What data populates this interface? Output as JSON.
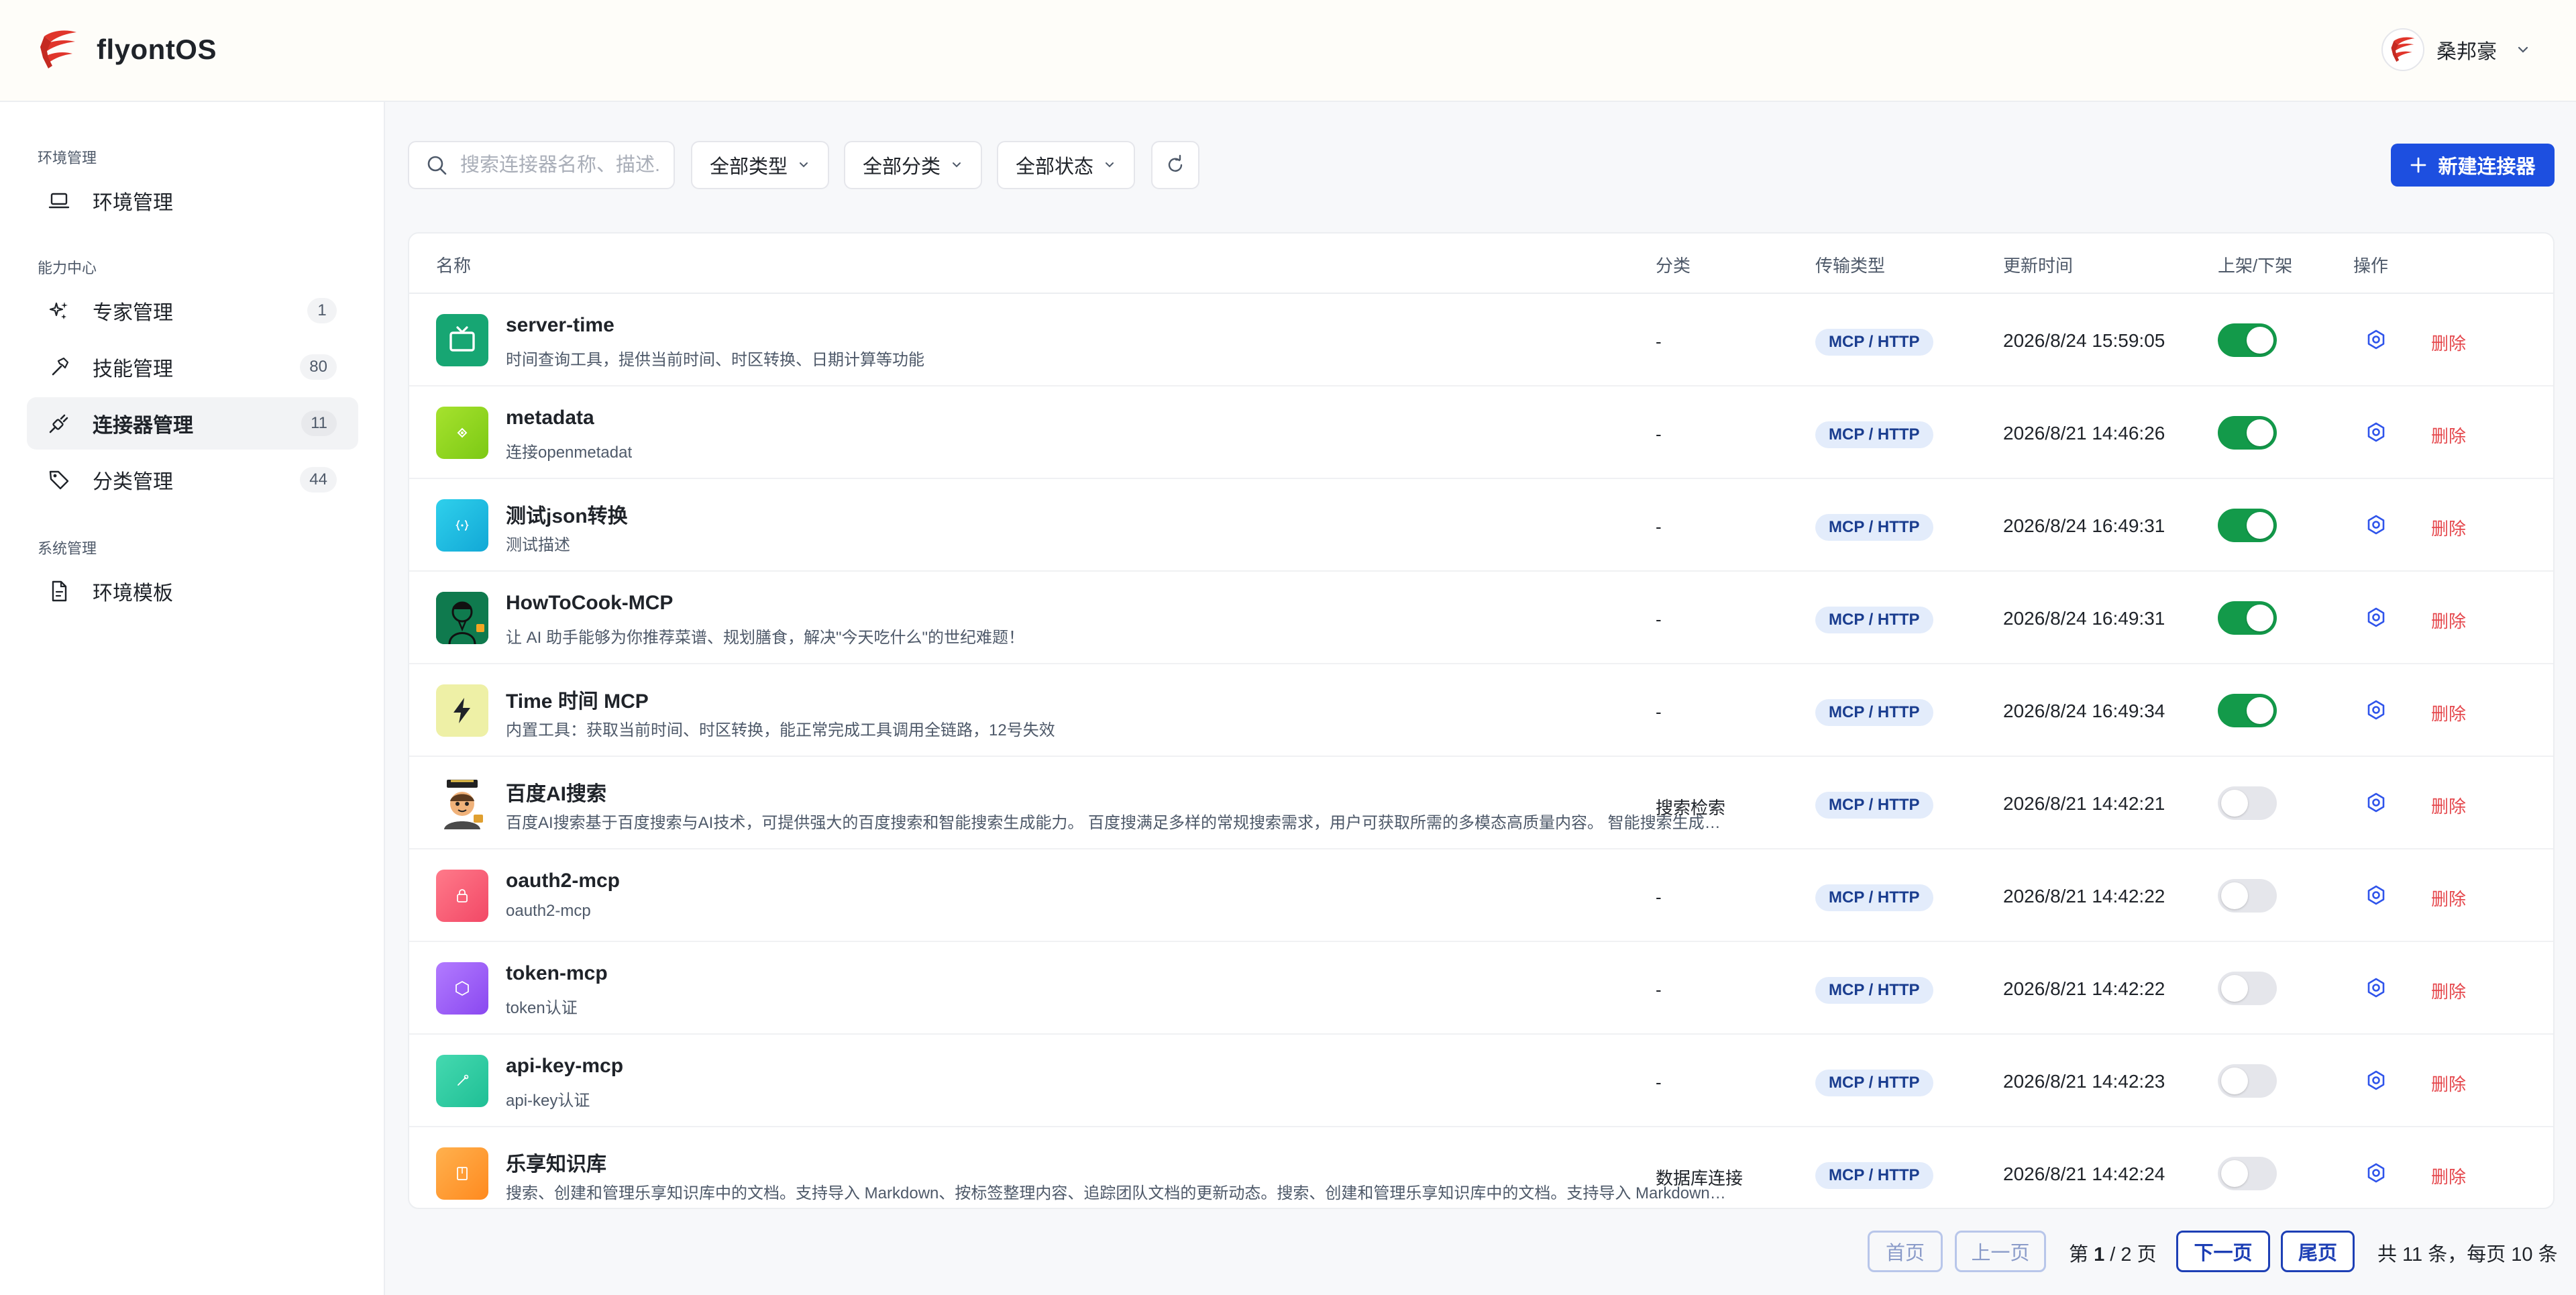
{
  "app": {
    "title": "flyontOS",
    "user_name": "桑邦豪"
  },
  "sidebar": {
    "groups": [
      {
        "title": "环境管理",
        "items": [
          {
            "label": "环境管理",
            "icon": "laptop-icon"
          }
        ]
      },
      {
        "title": "能力中心",
        "items": [
          {
            "label": "专家管理",
            "count": "1",
            "icon": "sparkle-icon"
          },
          {
            "label": "技能管理",
            "count": "80",
            "icon": "hammer-icon"
          },
          {
            "label": "连接器管理",
            "count": "11",
            "icon": "plug-icon",
            "active": true
          },
          {
            "label": "分类管理",
            "count": "44",
            "icon": "tag-icon"
          }
        ]
      },
      {
        "title": "系统管理",
        "items": [
          {
            "label": "环境模板",
            "icon": "file-template-icon"
          }
        ]
      }
    ]
  },
  "toolbar": {
    "search_placeholder": "搜索连接器名称、描述...",
    "filter_type": "全部类型",
    "filter_category": "全部分类",
    "filter_status": "全部状态",
    "new_button": "新建连接器"
  },
  "table": {
    "columns": [
      "名称",
      "分类",
      "传输类型",
      "更新时间",
      "上架/下架",
      "操作"
    ],
    "delete_label": "删除",
    "rows": [
      {
        "name": "server-time",
        "desc": "时间查询工具，提供当前时间、时区转换、日期计算等功能",
        "category": "-",
        "transport": "MCP / HTTP",
        "updated": "2026/8/24 15:59:05",
        "enabled": true,
        "icon": "tv-icon",
        "icon_bg": "#17a673"
      },
      {
        "name": "metadata",
        "desc": "连接openmetadat",
        "category": "-",
        "transport": "MCP / HTTP",
        "updated": "2026/8/21 14:46:26",
        "enabled": true,
        "icon": "metadata-icon",
        "icon_bg": "#8fd61d"
      },
      {
        "name": "测试json转换",
        "desc": "测试描述",
        "category": "-",
        "transport": "MCP / HTTP",
        "updated": "2026/8/24 16:49:31",
        "enabled": true,
        "icon": "braces-icon",
        "icon_bg": "#1cb9de"
      },
      {
        "name": "HowToCook-MCP",
        "desc": "让 AI 助手能够为你推荐菜谱、规划膳食，解决\"今天吃什么\"的世纪难题！",
        "category": "-",
        "transport": "MCP / HTTP",
        "updated": "2026/8/24 16:49:31",
        "enabled": true,
        "icon": "chef-icon",
        "icon_bg": "#0f7a4e"
      },
      {
        "name": "Time 时间 MCP",
        "desc": "内置工具：获取当前时间、时区转换，能正常完成工具调用全链路，12号失效",
        "category": "-",
        "transport": "MCP / HTTP",
        "updated": "2026/8/24 16:49:34",
        "enabled": true,
        "icon": "lightning-icon",
        "icon_bg": "#eef0a6"
      },
      {
        "name": "百度AI搜索",
        "desc": "百度AI搜索基于百度搜索与AI技术，可提供强大的百度搜索和智能搜索生成能力。 百度搜满足多样的常规搜索需求，用户可获取所需的多模态高质量内容。 智能搜索生成基于大模型能力，结合实时搜索结果生成答案",
        "category": "搜索检索",
        "transport": "MCP / HTTP",
        "updated": "2026/8/21 14:42:21",
        "enabled": false,
        "icon": "mascot-icon",
        "icon_bg": "#ffffff"
      },
      {
        "name": "oauth2-mcp",
        "desc": "oauth2-mcp",
        "category": "-",
        "transport": "MCP / HTTP",
        "updated": "2026/8/21 14:42:22",
        "enabled": false,
        "icon": "lock-icon",
        "icon_bg": "#f25c78"
      },
      {
        "name": "token-mcp",
        "desc": "token认证",
        "category": "-",
        "transport": "MCP / HTTP",
        "updated": "2026/8/21 14:42:22",
        "enabled": false,
        "icon": "hexagon-icon",
        "icon_bg": "#9b5cf2"
      },
      {
        "name": "api-key-mcp",
        "desc": "api-key认证",
        "category": "-",
        "transport": "MCP / HTTP",
        "updated": "2026/8/21 14:42:23",
        "enabled": false,
        "icon": "key-icon",
        "icon_bg": "#2ec9a0"
      },
      {
        "name": "乐享知识库",
        "desc": "搜索、创建和管理乐享知识库中的文档。支持导入 Markdown、按标签整理内容、追踪团队文档的更新动态。搜索、创建和管理乐享知识库中的文档。支持导入 Markdown、按标签整理内容",
        "category": "数据库连接",
        "transport": "MCP / HTTP",
        "updated": "2026/8/21 14:42:24",
        "enabled": false,
        "icon": "book-icon",
        "icon_bg": "#ff9a2e"
      }
    ]
  },
  "pagination": {
    "first": "首页",
    "prev": "上一页",
    "next": "下一页",
    "last": "尾页",
    "page_prefix": "第",
    "current_page": "1",
    "page_sep": "/",
    "total_pages": "2 页",
    "summary": "共 11 条，每页 10 条"
  }
}
